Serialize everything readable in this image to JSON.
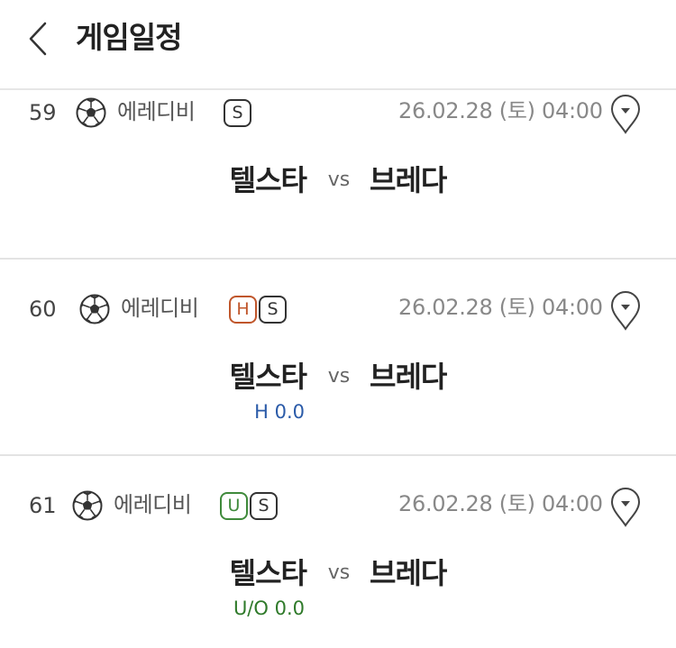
{
  "header": {
    "title": "게임일정"
  },
  "games": [
    {
      "number": "59",
      "league": "에레디비",
      "badges": [
        {
          "label": "S",
          "type": "s"
        }
      ],
      "datetime": "26.02.28 (토) 04:00",
      "home": "텔스타",
      "vs": "vs",
      "away": "브레다",
      "handicap": "",
      "handicap_color": ""
    },
    {
      "number": "60",
      "league": "에레디비",
      "badges": [
        {
          "label": "H",
          "type": "h"
        },
        {
          "label": "S",
          "type": "s"
        }
      ],
      "datetime": "26.02.28 (토) 04:00",
      "home": "텔스타",
      "vs": "vs",
      "away": "브레다",
      "handicap": "H 0.0",
      "handicap_color": "#2a5aa8"
    },
    {
      "number": "61",
      "league": "에레디비",
      "badges": [
        {
          "label": "U",
          "type": "u"
        },
        {
          "label": "S",
          "type": "s"
        }
      ],
      "datetime": "26.02.28 (토) 04:00",
      "home": "텔스타",
      "vs": "vs",
      "away": "브레다",
      "handicap": "U/O 0.0",
      "handicap_color": "#2f7a2a"
    }
  ],
  "icons": {
    "back": "chevron-left-icon",
    "sport": "soccer-ball-icon",
    "pin": "location-pin-icon"
  }
}
